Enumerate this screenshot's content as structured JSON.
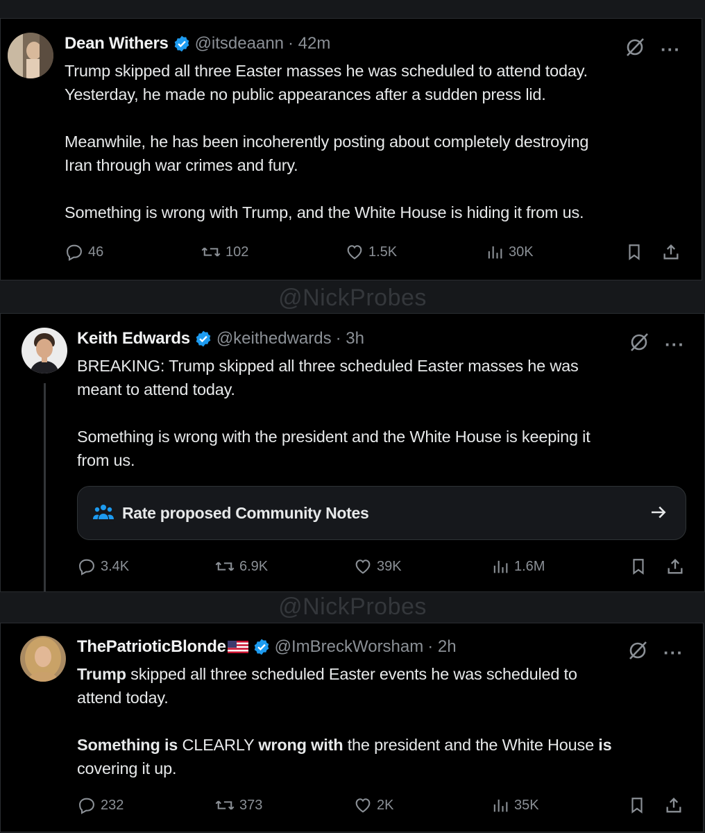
{
  "watermark": "@NickProbes",
  "tweets": [
    {
      "name": "Dean Withers",
      "handle": "@itsdeaann",
      "time": "· 42m",
      "paragraphs": [
        [
          "Trump skipped all three Easter masses he was scheduled to attend today.",
          "Yesterday, he made no public appearances after a sudden press lid."
        ],
        [
          "Meanwhile, he has been incoherently posting about completely destroying",
          "Iran through war crimes and fury."
        ],
        [
          "Something is wrong with Trump, and the White House is hiding it from us."
        ]
      ],
      "replies": "46",
      "reposts": "102",
      "likes": "1.5K",
      "views": "30K"
    },
    {
      "name": "Keith Edwards",
      "handle": "@keithedwards",
      "time": "· 3h",
      "paragraphs": [
        [
          "BREAKING: Trump skipped all three scheduled Easter masses he was",
          "meant to attend today."
        ],
        [
          "Something is wrong with the president and the White House is keeping it",
          "from us."
        ]
      ],
      "community_note": "Rate proposed Community Notes",
      "replies": "3.4K",
      "reposts": "6.9K",
      "likes": "39K",
      "views": "1.6M"
    },
    {
      "name": "ThePatrioticBlonde",
      "handle": "@ImBreckWorsham",
      "time": "· 2h",
      "line1": {
        "bold": "Trump",
        "rest": " skipped all three scheduled Easter events he was scheduled to"
      },
      "line2": "attend today.",
      "line3": [
        {
          "t": "Something is",
          "b": true
        },
        {
          "t": " CLEARLY ",
          "b": false
        },
        {
          "t": "wrong with",
          "b": true
        },
        {
          "t": " the president and the White House ",
          "b": false
        },
        {
          "t": "is",
          "b": true
        }
      ],
      "line4": "covering it up.",
      "replies": "232",
      "reposts": "373",
      "likes": "2K",
      "views": "35K"
    }
  ],
  "colors": {
    "background": "#000000",
    "verified": "#1d9bf0",
    "muted": "#8b9096",
    "text": "#e7e9ea"
  },
  "icons": [
    "verified-badge-icon",
    "grok-icon",
    "more-icon",
    "reply-icon",
    "repost-icon",
    "like-icon",
    "views-icon",
    "bookmark-icon",
    "share-icon",
    "community-notes-icon",
    "arrow-right-icon",
    "us-flag-icon"
  ]
}
